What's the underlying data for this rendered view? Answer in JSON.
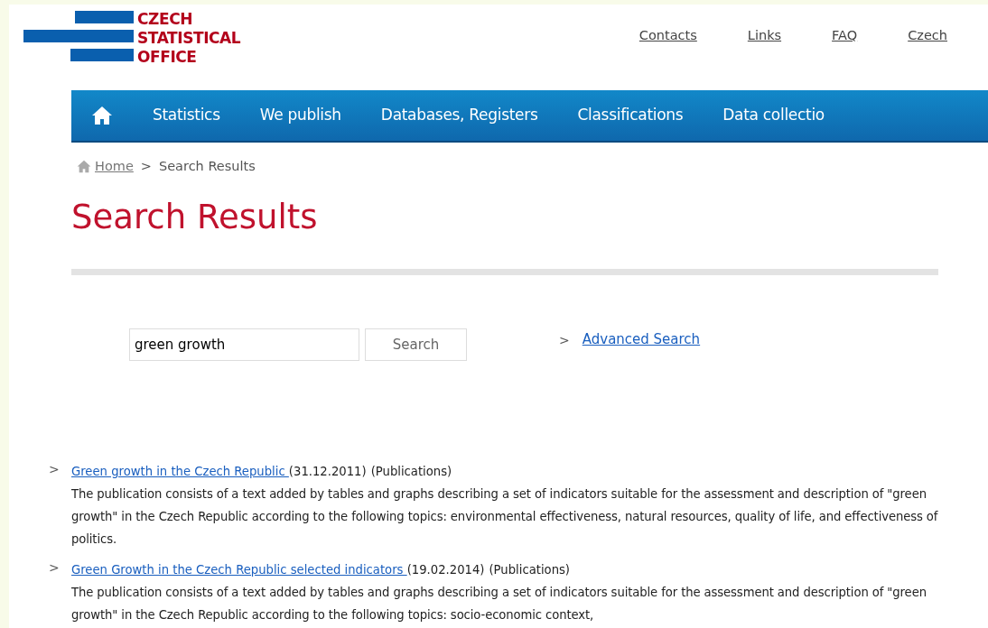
{
  "logo": {
    "lines": [
      "CZECH",
      "STATISTICAL",
      "OFFICE"
    ]
  },
  "top_links": [
    "Contacts",
    "Links",
    "FAQ",
    "Czech"
  ],
  "nav": {
    "items": [
      "Statistics",
      "We publish",
      "Databases, Registers",
      "Classifications",
      "Data collectio"
    ]
  },
  "breadcrumb": {
    "home": "Home",
    "separator": ">",
    "current": "Search Results"
  },
  "heading": "Search Results",
  "search": {
    "value": "green growth",
    "button": "Search",
    "chevron": ">",
    "advanced": "Advanced Search"
  },
  "results": [
    {
      "chevron": ">",
      "title": "Green growth in the Czech Republic ",
      "date": "(31.12.2011)",
      "category": "(Publications)",
      "description": "The publication consists of a text added by tables and graphs describing a set of indicators suitable for the assessment and description of \"green growth\" in the Czech Republic according to the following topics: environmental effectiveness, natural resources, quality of life, and effectiveness of politics."
    },
    {
      "chevron": ">",
      "title": "Green Growth in the Czech Republic selected indicators ",
      "date": "(19.02.2014)",
      "category": "(Publications)",
      "description": "The publication consists of a text added by tables and graphs describing a set of indicators suitable for the assessment and description of \"green growth\" in the Czech Republic according to the following topics: socio-economic context,"
    }
  ]
}
